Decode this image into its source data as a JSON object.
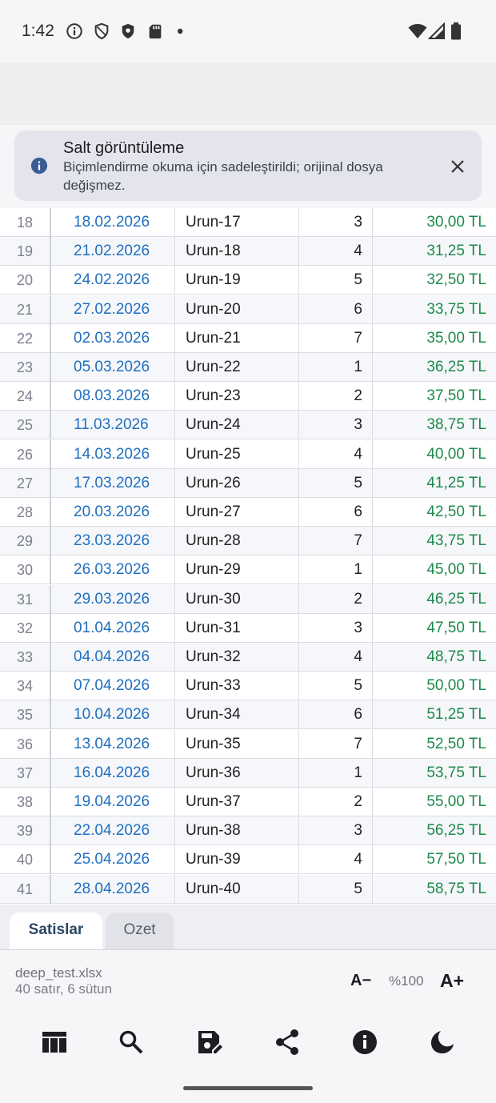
{
  "status_bar": {
    "time": "1:42"
  },
  "banner": {
    "title": "Salt görüntüleme",
    "text": "Biçimlendirme okuma için sadeleştirildi; orijinal dosya değişmez."
  },
  "table": {
    "rows": [
      {
        "index": "18",
        "date": "18.02.2026",
        "product": "Urun-17",
        "qty": "3",
        "price": "30,00 TL"
      },
      {
        "index": "19",
        "date": "21.02.2026",
        "product": "Urun-18",
        "qty": "4",
        "price": "31,25 TL"
      },
      {
        "index": "20",
        "date": "24.02.2026",
        "product": "Urun-19",
        "qty": "5",
        "price": "32,50 TL"
      },
      {
        "index": "21",
        "date": "27.02.2026",
        "product": "Urun-20",
        "qty": "6",
        "price": "33,75 TL"
      },
      {
        "index": "22",
        "date": "02.03.2026",
        "product": "Urun-21",
        "qty": "7",
        "price": "35,00 TL"
      },
      {
        "index": "23",
        "date": "05.03.2026",
        "product": "Urun-22",
        "qty": "1",
        "price": "36,25 TL"
      },
      {
        "index": "24",
        "date": "08.03.2026",
        "product": "Urun-23",
        "qty": "2",
        "price": "37,50 TL"
      },
      {
        "index": "25",
        "date": "11.03.2026",
        "product": "Urun-24",
        "qty": "3",
        "price": "38,75 TL"
      },
      {
        "index": "26",
        "date": "14.03.2026",
        "product": "Urun-25",
        "qty": "4",
        "price": "40,00 TL"
      },
      {
        "index": "27",
        "date": "17.03.2026",
        "product": "Urun-26",
        "qty": "5",
        "price": "41,25 TL"
      },
      {
        "index": "28",
        "date": "20.03.2026",
        "product": "Urun-27",
        "qty": "6",
        "price": "42,50 TL"
      },
      {
        "index": "29",
        "date": "23.03.2026",
        "product": "Urun-28",
        "qty": "7",
        "price": "43,75 TL"
      },
      {
        "index": "30",
        "date": "26.03.2026",
        "product": "Urun-29",
        "qty": "1",
        "price": "45,00 TL"
      },
      {
        "index": "31",
        "date": "29.03.2026",
        "product": "Urun-30",
        "qty": "2",
        "price": "46,25 TL"
      },
      {
        "index": "32",
        "date": "01.04.2026",
        "product": "Urun-31",
        "qty": "3",
        "price": "47,50 TL"
      },
      {
        "index": "33",
        "date": "04.04.2026",
        "product": "Urun-32",
        "qty": "4",
        "price": "48,75 TL"
      },
      {
        "index": "34",
        "date": "07.04.2026",
        "product": "Urun-33",
        "qty": "5",
        "price": "50,00 TL"
      },
      {
        "index": "35",
        "date": "10.04.2026",
        "product": "Urun-34",
        "qty": "6",
        "price": "51,25 TL"
      },
      {
        "index": "36",
        "date": "13.04.2026",
        "product": "Urun-35",
        "qty": "7",
        "price": "52,50 TL"
      },
      {
        "index": "37",
        "date": "16.04.2026",
        "product": "Urun-36",
        "qty": "1",
        "price": "53,75 TL"
      },
      {
        "index": "38",
        "date": "19.04.2026",
        "product": "Urun-37",
        "qty": "2",
        "price": "55,00 TL"
      },
      {
        "index": "39",
        "date": "22.04.2026",
        "product": "Urun-38",
        "qty": "3",
        "price": "56,25 TL"
      },
      {
        "index": "40",
        "date": "25.04.2026",
        "product": "Urun-39",
        "qty": "4",
        "price": "57,50 TL"
      },
      {
        "index": "41",
        "date": "28.04.2026",
        "product": "Urun-40",
        "qty": "5",
        "price": "58,75 TL"
      }
    ]
  },
  "sheet_tabs": [
    {
      "label": "Satislar",
      "active": true
    },
    {
      "label": "Ozet",
      "active": false
    }
  ],
  "footer": {
    "file_name": "deep_test.xlsx",
    "file_info": "40 satır, 6 sütun",
    "zoom_minus": "A−",
    "zoom_level": "%100",
    "zoom_plus": "A+"
  },
  "nav_icons": [
    "table-icon",
    "search-icon",
    "save-edit-icon",
    "share-icon",
    "info-icon",
    "dark-mode-icon"
  ],
  "colors": {
    "date_text": "#1f6fc0",
    "price_text": "#1e8a4c",
    "banner_bg": "#e4e5ec",
    "info_icon": "#3b5b95"
  }
}
